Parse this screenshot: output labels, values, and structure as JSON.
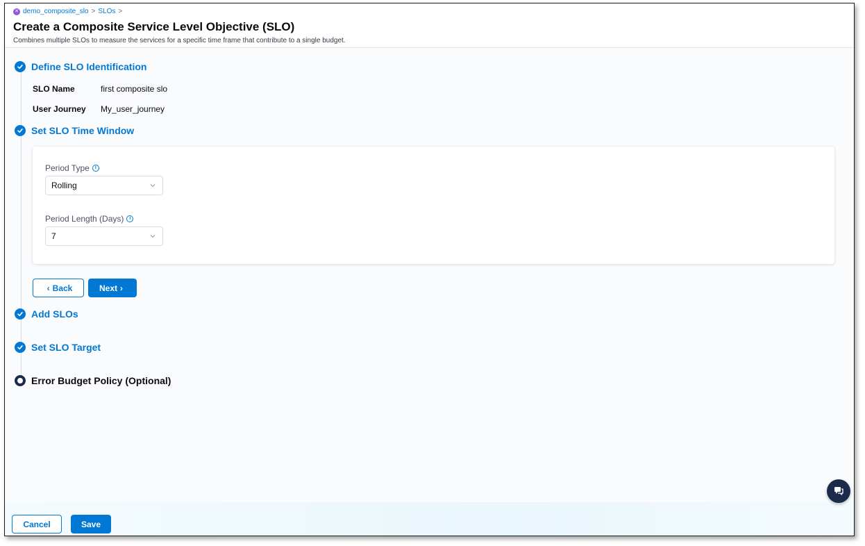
{
  "breadcrumb": {
    "items": [
      "demo_composite_slo",
      "SLOs"
    ],
    "separator": ">"
  },
  "page": {
    "title": "Create a Composite Service Level Objective (SLO)",
    "subtitle": "Combines multiple SLOs to measure the services for a specific time frame that contribute to a single budget."
  },
  "steps": [
    {
      "label": "Define SLO Identification",
      "state": "complete"
    },
    {
      "label": "Set SLO Time Window",
      "state": "complete"
    },
    {
      "label": "Add SLOs",
      "state": "complete"
    },
    {
      "label": "Set SLO Target",
      "state": "complete"
    },
    {
      "label": "Error Budget Policy (Optional)",
      "state": "current"
    }
  ],
  "identification": {
    "slo_name_label": "SLO Name",
    "slo_name_value": "first composite slo",
    "user_journey_label": "User Journey",
    "user_journey_value": "My_user_journey"
  },
  "time_window": {
    "period_type_label": "Period Type",
    "period_type_value": "Rolling",
    "period_length_label": "Period Length (Days)",
    "period_length_value": "7"
  },
  "nav_buttons": {
    "back": "Back",
    "next": "Next"
  },
  "footer": {
    "cancel": "Cancel",
    "save": "Save"
  },
  "colors": {
    "primary": "#0278d5",
    "dark_navy": "#1b2b4c",
    "text": "#0b0b0d"
  }
}
